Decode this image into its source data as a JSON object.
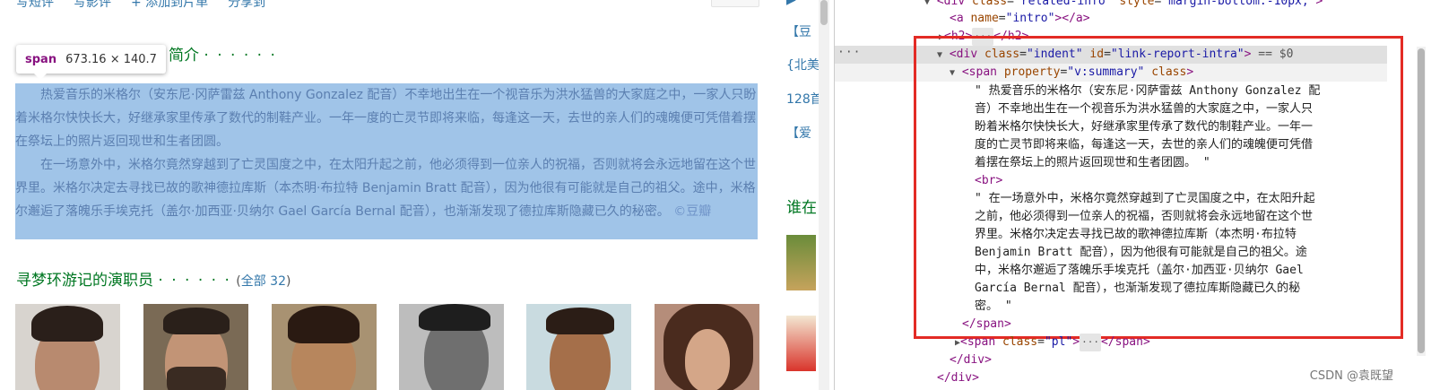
{
  "page": {
    "topbar": [
      "写短评",
      "写影评",
      "+ 添加到片单",
      "分享到"
    ],
    "tooltip": {
      "tag": "span",
      "size": "673.16 × 140.7"
    },
    "intro_heading": "简介",
    "intro_dots": "· · · · · ·",
    "summary_p1": "热爱音乐的米格尔（安东尼·冈萨雷兹 Anthony Gonzalez 配音）不幸地出生在一个视音乐为洪水猛兽的大家庭之中，一家人只盼着米格尔快快长大，好继承家里传承了数代的制鞋产业。一年一度的亡灵节即将来临，每逢这一天，去世的亲人们的魂魄便可凭借着摆在祭坛上的照片返回现世和生者团圆。",
    "summary_p2": "在一场意外中，米格尔竟然穿越到了亡灵国度之中，在太阳升起之前，他必须得到一位亲人的祝福，否则就将会永远地留在这个世界里。米格尔决定去寻找已故的歌神德拉库斯（本杰明·布拉特 Benjamin Bratt 配音），因为他很有可能就是自己的祖父。途中，米格尔邂逅了落魄乐手埃克托（盖尔·加西亚·贝纳尔 Gael García Bernal 配音），也渐渐发现了德拉库斯隐藏已久的秘密。",
    "summary_copy": "©豆瓣",
    "cast_heading": "寻梦环游记的演职员",
    "cast_dots": "· · · · · ·",
    "cast_all": "全部 32",
    "right_col": [
      "【豆",
      "{北美",
      "128首",
      "【爱"
    ],
    "right_heading": "谁在"
  },
  "devtools": {
    "line0": {
      "tag": "div",
      "attrs": "class=\"related-info\" style=\"margin-bottom:-10px;\""
    },
    "line1": {
      "tag": "a",
      "attr": "name",
      "val": "\"intro\""
    },
    "line2": {
      "tag": "h2"
    },
    "line3": {
      "tag": "div",
      "cls": "\"indent\"",
      "id": "\"link-report-intra\"",
      "suffix": "== $0"
    },
    "line4": {
      "tag": "span",
      "prop": "\"v:summary\"",
      "cls_name": "class"
    },
    "text1": "\" 热爱音乐的米格尔（安东尼·冈萨雷兹 Anthony Gonzalez 配\n音）不幸地出生在一个视音乐为洪水猛兽的大家庭之中，一家人只\n盼着米格尔快快长大，好继承家里传承了数代的制鞋产业。一年一\n度的亡灵节即将来临，每逢这一天，去世的亲人们的魂魄便可凭借\n着摆在祭坛上的照片返回现世和生者团圆。 \"",
    "br": "<br>",
    "text2": "\" 在一场意外中，米格尔竟然穿越到了亡灵国度之中，在太阳升起\n之前，他必须得到一位亲人的祝福，否则就将会永远地留在这个世\n界里。米格尔决定去寻找已故的歌神德拉库斯（本杰明·布拉特\nBenjamin Bratt 配音），因为他很有可能就是自己的祖父。途\n中，米格尔邂逅了落魄乐手埃克托（盖尔·加西亚·贝纳尔 Gael\nGarcía Bernal 配音），也渐渐发现了德拉库斯隐藏已久的秘\n密。 \"",
    "span_close": "</span>",
    "line_pl": {
      "tag": "span",
      "cls": "\"pl\""
    },
    "div_close": "</div>",
    "div_close2": "</div>",
    "ellipsis": "···",
    "watermark": "CSDN @袁既望"
  }
}
